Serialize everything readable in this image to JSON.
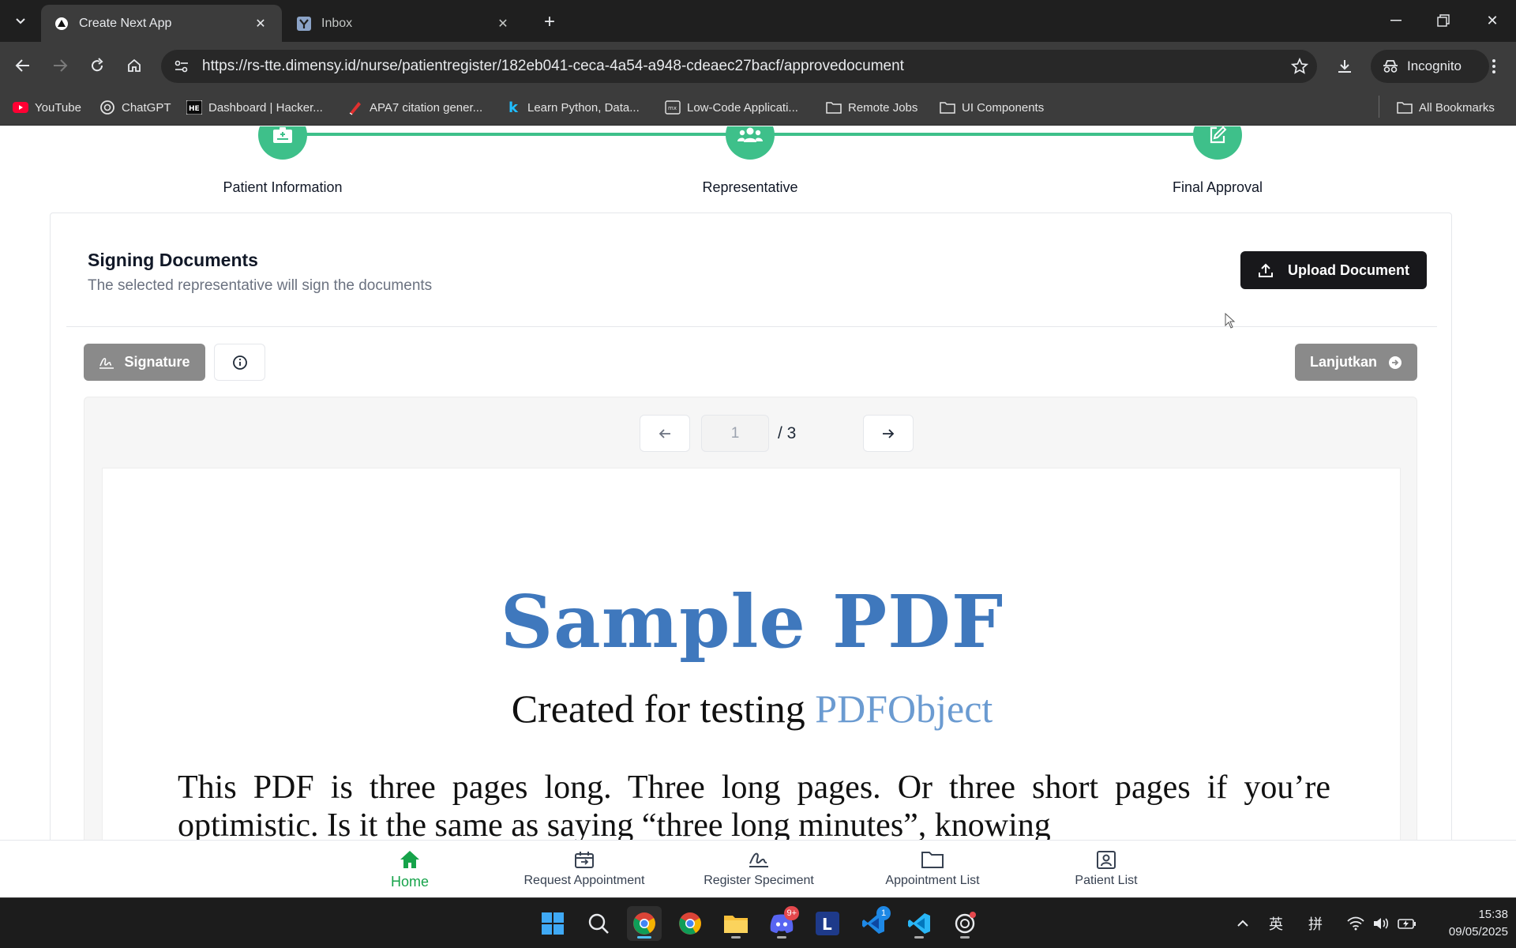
{
  "browser": {
    "tabs": [
      {
        "title": "Create Next App",
        "active": true
      },
      {
        "title": "Inbox",
        "active": false
      }
    ],
    "url": "https://rs-tte.dimensy.id/nurse/patientregister/182eb041-ceca-4a54-a948-cdeaec27bacf/approvedocument",
    "incognito_label": "Incognito",
    "bookmarks": [
      "YouTube",
      "ChatGPT",
      "Dashboard | Hacker...",
      "APA7 citation gener...",
      "Learn Python, Data...",
      "Low-Code Applicati...",
      "Remote Jobs",
      "UI Components"
    ],
    "all_bookmarks_label": "All Bookmarks"
  },
  "stepper": {
    "steps": [
      "Patient Information",
      "Representative",
      "Final Approval"
    ]
  },
  "signing": {
    "title": "Signing Documents",
    "subtitle": "The selected representative will sign the documents",
    "upload_label": "Upload Document",
    "signature_label": "Signature",
    "continue_label": "Lanjutkan"
  },
  "viewer": {
    "current_page": "1",
    "total_pages": "/ 3",
    "pdf_title": "Sample PDF",
    "pdf_subtitle_prefix": "Created for testing",
    "pdf_subtitle_highlight": "PDFObject",
    "pdf_body": "This PDF is three pages long. Three long pages. Or three short pages if you’re optimistic. Is it the same as saying “three long minutes”, knowing"
  },
  "bottom_nav": [
    {
      "label": "Home",
      "icon": "home-icon",
      "active": true
    },
    {
      "label": "Request Appointment",
      "icon": "request-appointment-icon",
      "active": false
    },
    {
      "label": "Register Speciment",
      "icon": "signature-icon",
      "active": false
    },
    {
      "label": "Appointment List",
      "icon": "folder-icon",
      "active": false
    },
    {
      "label": "Patient List",
      "icon": "patient-list-icon",
      "active": false
    }
  ],
  "taskbar": {
    "ime_lang": "英",
    "ime_mode": "拼",
    "time": "15:38",
    "date": "09/05/2025",
    "discord_badge": "9+",
    "vscode_insider_badge": "1"
  },
  "colors": {
    "accent_green": "#3ec08a",
    "nav_active": "#16a34a",
    "pdf_title_blue": "#3f78bd",
    "upload_button": "#18181b",
    "disabled_button": "#8a8a8a"
  }
}
